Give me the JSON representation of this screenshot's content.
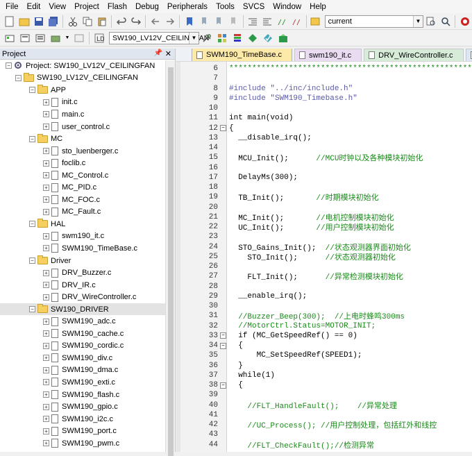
{
  "menu": [
    "File",
    "Edit",
    "View",
    "Project",
    "Flash",
    "Debug",
    "Peripherals",
    "Tools",
    "SVCS",
    "Window",
    "Help"
  ],
  "toolbar1": {
    "combo_value": "current"
  },
  "toolbar2": {
    "target_value": "SW190_LV12V_CEILINGFAN"
  },
  "project_panel": {
    "title": "Project",
    "pin": "p",
    "root": "Project: SW190_LV12V_CEILINGFAN",
    "target": "SW190_LV12V_CEILINGFAN",
    "groups": [
      {
        "name": "APP",
        "files": [
          "init.c",
          "main.c",
          "user_control.c"
        ]
      },
      {
        "name": "MC",
        "files": [
          "sto_luenberger.c",
          "foclib.c",
          "MC_Control.c",
          "MC_PID.c",
          "MC_FOC.c",
          "MC_Fault.c"
        ]
      },
      {
        "name": "HAL",
        "files": [
          "swm190_it.c",
          "SWM190_TimeBase.c"
        ]
      },
      {
        "name": "Driver",
        "files": [
          "DRV_Buzzer.c",
          "DRV_IR.c",
          "DRV_WireController.c"
        ]
      },
      {
        "name": "SW190_DRIVER",
        "files": [
          "SWM190_adc.c",
          "SWM190_cache.c",
          "SWM190_cordic.c",
          "SWM190_div.c",
          "SWM190_dma.c",
          "SWM190_exti.c",
          "SWM190_flash.c",
          "SWM190_gpio.c",
          "SWM190_i2c.c",
          "SWM190_port.c",
          "SWM190_pwm.c"
        ]
      }
    ]
  },
  "tabs": [
    {
      "label": "SWM190_TimeBase.c",
      "color": "#fde9a8",
      "active": true
    },
    {
      "label": "swm190_it.c",
      "color": "#e9dcf2",
      "active": false
    },
    {
      "label": "DRV_WireController.c",
      "color": "#d6ecd9",
      "active": false
    },
    {
      "label": "focli",
      "color": "#dde6f3",
      "active": false
    }
  ],
  "code_lines": [
    {
      "n": "6",
      "text": "**********************************************************"
    },
    {
      "n": "7",
      "text": ""
    },
    {
      "n": "8",
      "text": "#include \"../inc/include.h\""
    },
    {
      "n": "9",
      "text": "#include \"SWM190_Timebase.h\""
    },
    {
      "n": "10",
      "text": ""
    },
    {
      "n": "11",
      "text": "int main(void)"
    },
    {
      "n": "12",
      "text": "{"
    },
    {
      "n": "13",
      "text": "  __disable_irq();"
    },
    {
      "n": "14",
      "text": ""
    },
    {
      "n": "15",
      "text": "  MCU_Init();      //MCU时钟以及各种模块初始化"
    },
    {
      "n": "16",
      "text": ""
    },
    {
      "n": "17",
      "text": "  DelayMs(300);"
    },
    {
      "n": "18",
      "text": ""
    },
    {
      "n": "19",
      "text": "  TB_Init();       //时期模块初始化"
    },
    {
      "n": "20",
      "text": ""
    },
    {
      "n": "21",
      "text": "  MC_Init();       //电机控制模块初始化"
    },
    {
      "n": "22",
      "text": "  UC_Init();       //用户控制模块初始化"
    },
    {
      "n": "23",
      "text": ""
    },
    {
      "n": "24",
      "text": "  STO_Gains_Init();  //状态观测器界面初始化"
    },
    {
      "n": "25",
      "text": "    STO_Init();      //状态观测器初始化"
    },
    {
      "n": "26",
      "text": ""
    },
    {
      "n": "27",
      "text": "    FLT_Init();      //异常检测模块初始化"
    },
    {
      "n": "28",
      "text": ""
    },
    {
      "n": "29",
      "text": "  __enable_irq();"
    },
    {
      "n": "30",
      "text": ""
    },
    {
      "n": "31",
      "text": "  //Buzzer_Beep(300);  //上电时蜂鸣300ms"
    },
    {
      "n": "32",
      "text": "  //MotorCtrl.Status=MOTOR_INIT;"
    },
    {
      "n": "33",
      "text": "  if (MC_GetSpeedRef() == 0)"
    },
    {
      "n": "34",
      "text": "  {"
    },
    {
      "n": "35",
      "text": "      MC_SetSpeedRef(SPEED1);"
    },
    {
      "n": "36",
      "text": "  }"
    },
    {
      "n": "37",
      "text": "  while(1)"
    },
    {
      "n": "38",
      "text": "  {"
    },
    {
      "n": "39",
      "text": ""
    },
    {
      "n": "40",
      "text": "    //FLT_HandleFault();    //异常处理"
    },
    {
      "n": "41",
      "text": ""
    },
    {
      "n": "42",
      "text": "    //UC_Process(); //用户控制处理，包括红外和线控"
    },
    {
      "n": "43",
      "text": ""
    },
    {
      "n": "44",
      "text": "    //FLT_CheckFault();//检测异常"
    }
  ]
}
